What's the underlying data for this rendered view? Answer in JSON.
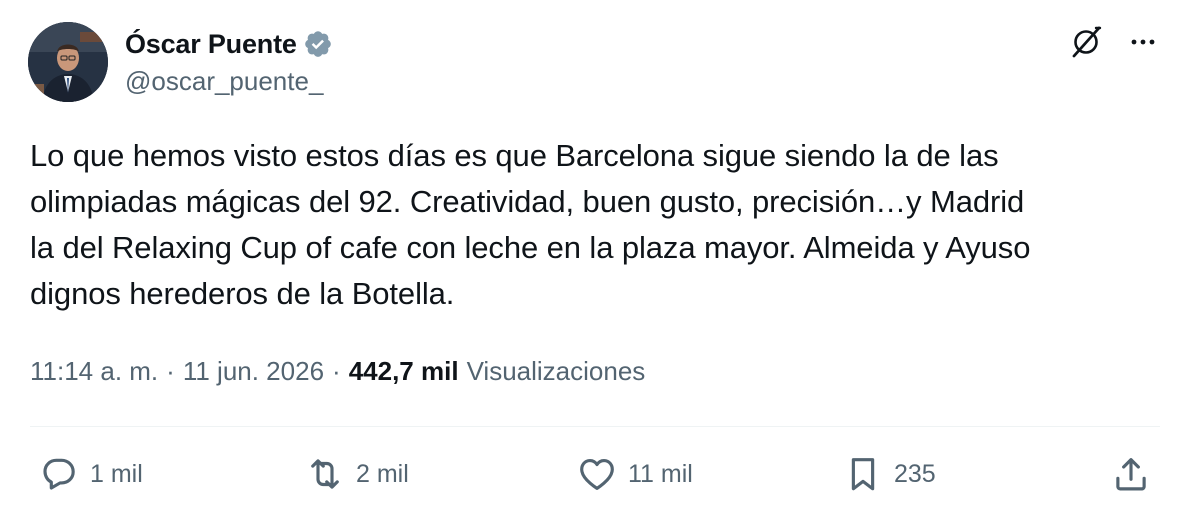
{
  "author": {
    "name": "Óscar Puente",
    "handle": "@oscar_puente_",
    "verified": true,
    "avatar_icon": "profile-photo"
  },
  "top_actions": {
    "grok_icon": "grok-icon",
    "more_icon": "more-icon"
  },
  "tweet": {
    "text": "Lo que hemos visto estos días es que Barcelona sigue siendo la de las\nolimpiadas mágicas del 92. Creatividad, buen gusto, precisión…y Madrid\nla del Relaxing Cup of cafe con leche en la plaza mayor. Almeida y Ayuso\ndignos herederos de la Botella."
  },
  "meta": {
    "time": "11:14 a. m.",
    "separator": "·",
    "date": "11 jun. 2026",
    "views_count": "442,7 mil",
    "views_label": "Visualizaciones"
  },
  "actions": {
    "reply": {
      "icon": "reply-icon",
      "count": "1 mil"
    },
    "retweet": {
      "icon": "retweet-icon",
      "count": "2 mil"
    },
    "like": {
      "icon": "like-icon",
      "count": "11 mil"
    },
    "bookmark": {
      "icon": "bookmark-icon",
      "count": "235"
    },
    "share": {
      "icon": "share-icon"
    }
  },
  "colors": {
    "text_primary": "#0f1419",
    "text_secondary": "#536471",
    "verified_badge": "#829aab",
    "divider": "#eff3f4"
  }
}
